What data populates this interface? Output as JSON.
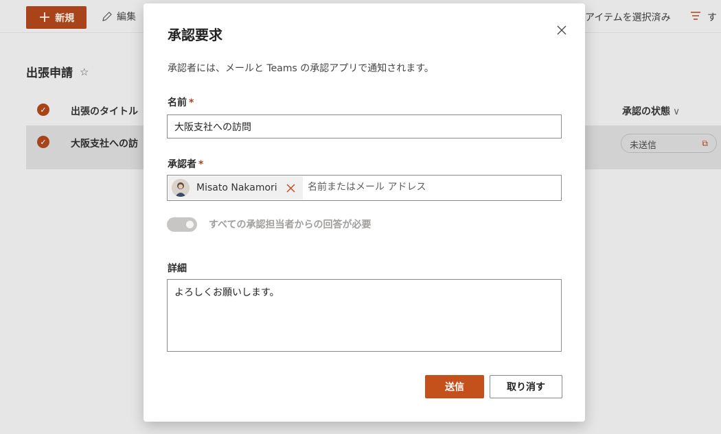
{
  "toolbar": {
    "new_label": "新規",
    "edit_label": "編集",
    "selection_text": "アイテムを選択済み",
    "filter_text": "す"
  },
  "list": {
    "title": "出張申請",
    "columns": {
      "title": "出張のタイトル",
      "status": "承認の状態"
    },
    "row": {
      "title": "大阪支社への訪",
      "status": "未送信"
    }
  },
  "dialog": {
    "title": "承認要求",
    "description": "承認者には、メールと Teams の承認アプリで通知されます。",
    "name_label": "名前",
    "name_value": "大阪支社への訪問",
    "approver_label": "承認者",
    "approver_name": "Misato Nakamori",
    "approver_placeholder": "名前またはメール アドレス",
    "toggle_label": "すべての承認担当者からの回答が必要",
    "details_label": "詳細",
    "details_value": "よろしくお願いします。",
    "send_label": "送信",
    "cancel_label": "取り消す",
    "required_mark": "*"
  },
  "colors": {
    "accent": "#c4501c",
    "accent_dark": "#a9441a"
  },
  "icons": [
    "plus-icon",
    "pencil-icon",
    "filter-icon",
    "star-icon",
    "check-circle-icon",
    "chevron-down-icon",
    "external-link-icon",
    "close-icon",
    "remove-icon",
    "avatar"
  ]
}
